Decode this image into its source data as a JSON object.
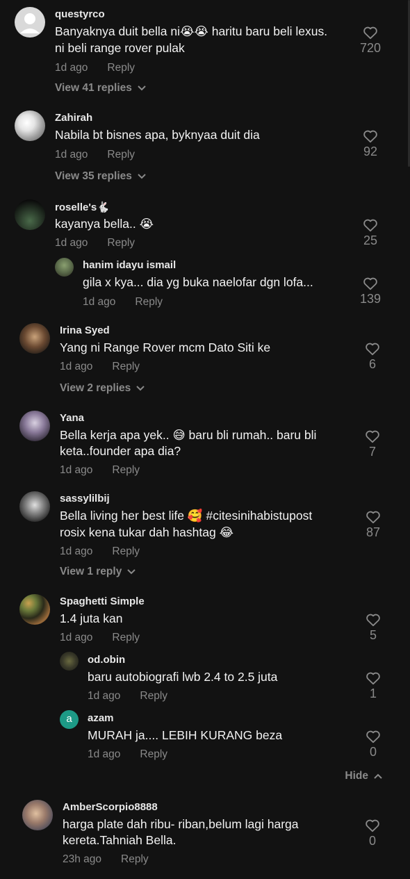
{
  "comments": [
    {
      "user": "questyrco",
      "text": [
        "Banyaknya duit bella ni😭😭 haritu baru beli lexus.",
        "ni beli range rover pulak"
      ],
      "time": "1d ago",
      "reply": "Reply",
      "likes": "720",
      "view_replies": "View 41 replies"
    },
    {
      "user": "Zahirah",
      "text": [
        "Nabila bt bisnes apa, byknyaa duit dia"
      ],
      "time": "1d ago",
      "reply": "Reply",
      "likes": "92",
      "view_replies": "View 35 replies"
    },
    {
      "user": "roselle's🐇",
      "text": [
        "kayanya bella.. 😭"
      ],
      "time": "1d ago",
      "reply": "Reply",
      "likes": "25",
      "replies": [
        {
          "user": "hanim idayu ismail",
          "text": [
            "gila x kya... dia yg buka naelofar dgn lofa..."
          ],
          "time": "1d ago",
          "reply": "Reply",
          "likes": "139"
        }
      ]
    },
    {
      "user": "Irina Syed",
      "text": [
        "Yang ni Range Rover mcm Dato Siti ke"
      ],
      "time": "1d ago",
      "reply": "Reply",
      "likes": "6",
      "view_replies": "View 2 replies"
    },
    {
      "user": "Yana",
      "text": [
        "Bella kerja apa yek.. 😅 baru bli rumah.. baru bli",
        "keta..founder apa dia?"
      ],
      "time": "1d ago",
      "reply": "Reply",
      "likes": "7"
    },
    {
      "user": "sassylilbij",
      "text": [
        "Bella living her best life 🥰 #citesinihabistupost",
        "rosix kena tukar dah hashtag 😂"
      ],
      "time": "1d ago",
      "reply": "Reply",
      "likes": "87",
      "view_replies": "View 1 reply"
    },
    {
      "user": "Spaghetti Simple",
      "text": [
        "1.4 juta kan"
      ],
      "time": "1d ago",
      "reply": "Reply",
      "likes": "5",
      "replies": [
        {
          "user": "od.obin",
          "text": [
            "baru autobiografi lwb 2.4 to 2.5 juta"
          ],
          "time": "1d ago",
          "reply": "Reply",
          "likes": "1"
        },
        {
          "user": "azam",
          "avatar_letter": "a",
          "text": [
            "MURAH ja.... LEBIH KURANG beza"
          ],
          "time": "1d ago",
          "reply": "Reply",
          "likes": "0"
        }
      ],
      "hide": "Hide"
    },
    {
      "user": "AmberScorpio8888",
      "text": [
        "harga plate dah ribu- riban,belum lagi harga",
        "kereta.Tahniah Bella."
      ],
      "time": "23h ago",
      "reply": "Reply",
      "likes": "0"
    }
  ],
  "colors": {
    "bg": "#121212",
    "text": "#f2f2f2",
    "muted": "#8a8a8a",
    "azam_avatar": "#1d9a86"
  },
  "icons": {
    "like": "heart-outline-icon",
    "expand": "chevron-down-icon",
    "collapse": "chevron-up-icon"
  }
}
